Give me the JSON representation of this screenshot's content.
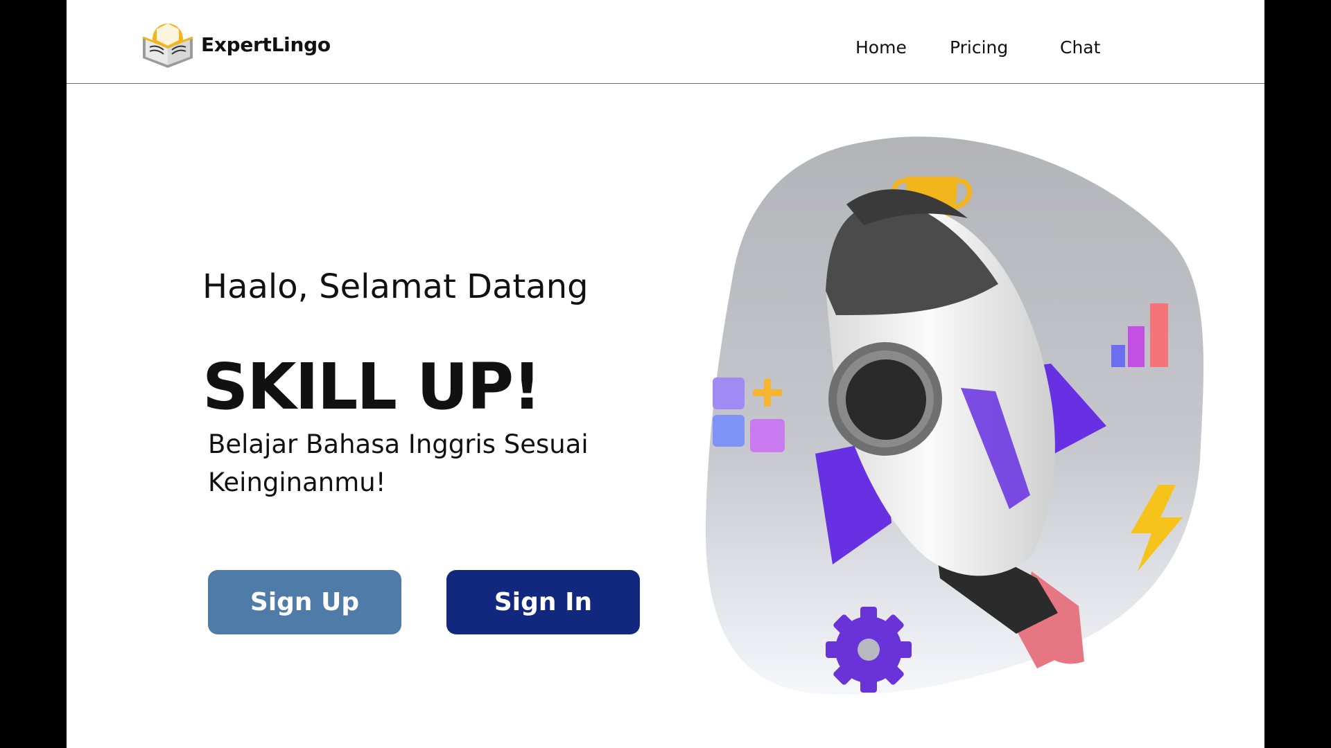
{
  "brand": {
    "name": "ExpertLingo",
    "logo_icon": "open-book-sun-logo"
  },
  "nav": {
    "home": "Home",
    "pricing": "Pricing",
    "chat": "Chat"
  },
  "hero": {
    "greeting": "Haalo, Selamat Datang",
    "headline": "SKILL UP!",
    "tagline_line1": "Belajar Bahasa Inggris Sesuai",
    "tagline_line2": "Keinginanmu!"
  },
  "buttons": {
    "signup": "Sign Up",
    "signin": "Sign In"
  },
  "illustration": {
    "icons": [
      "rocket-icon",
      "trophy-icon",
      "bar-chart-icon",
      "apps-grid-icon",
      "lightning-icon",
      "gear-icon"
    ]
  },
  "colors": {
    "signup_button": "#4f7ba8",
    "signin_button": "#12287e",
    "accent_purple": "#6730e3",
    "background_frame": "#000000"
  }
}
